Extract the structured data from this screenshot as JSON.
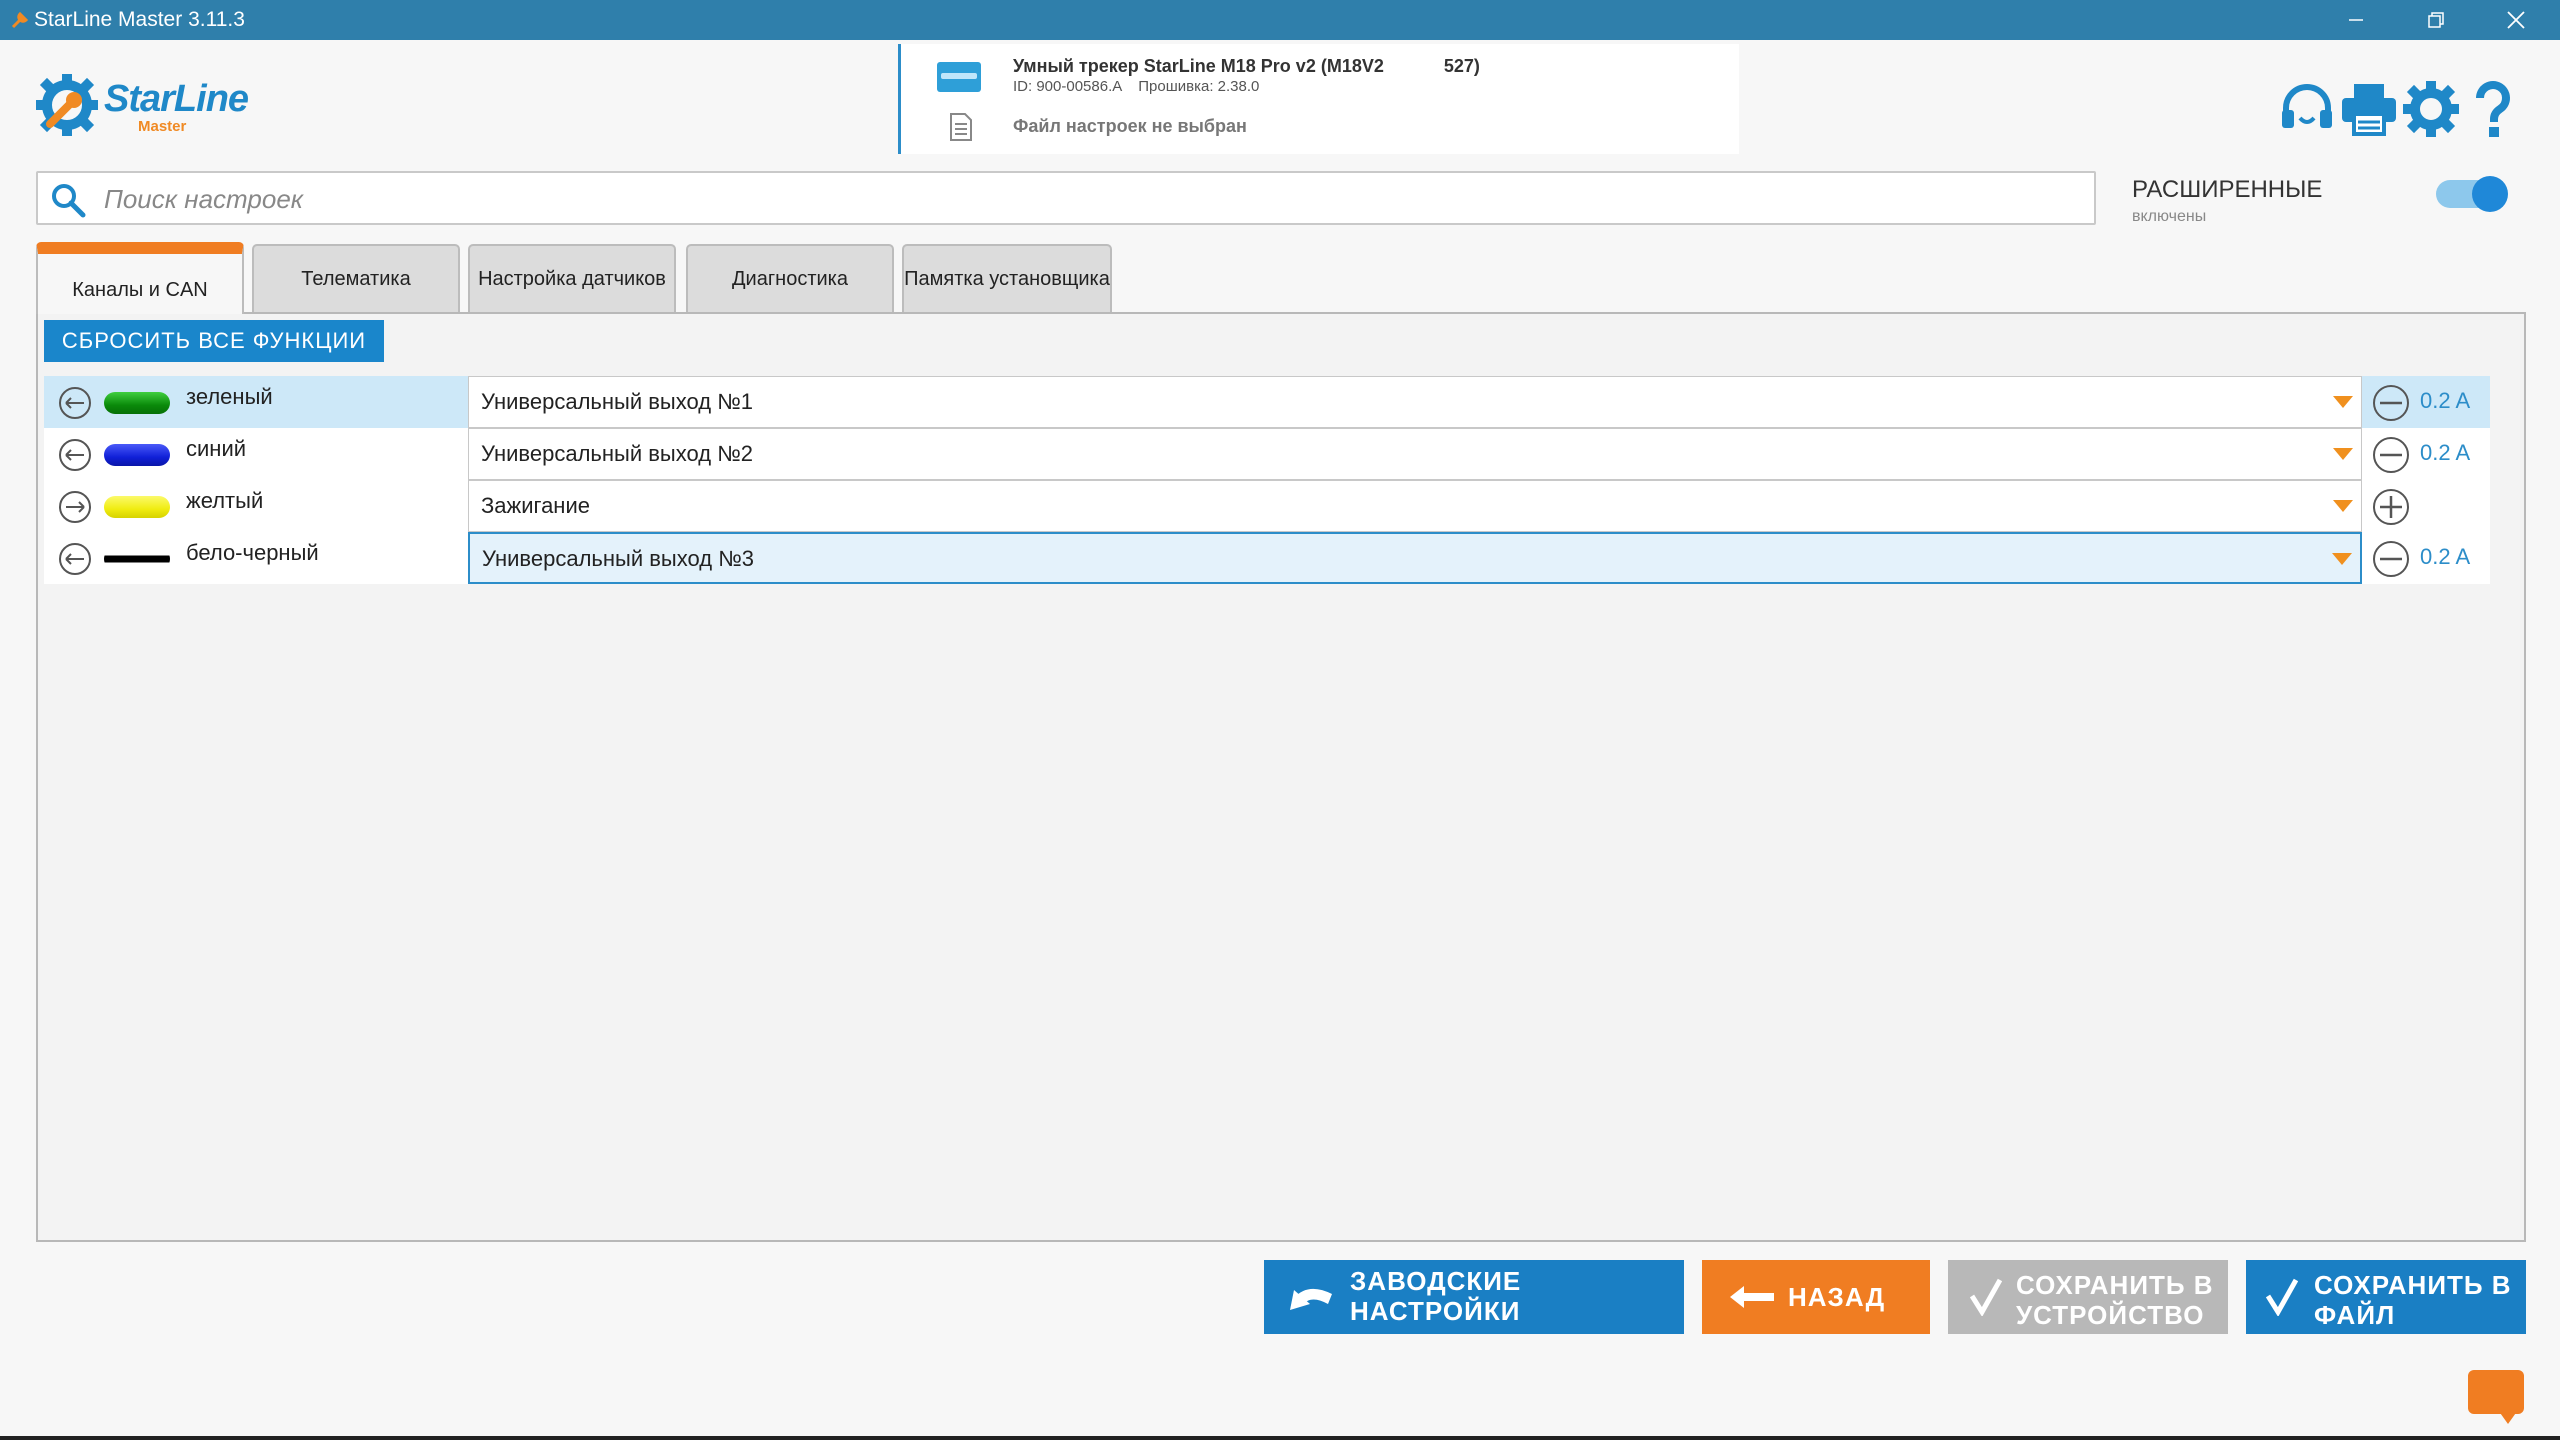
{
  "window": {
    "title": "StarLine Master 3.11.3",
    "titlebar_color": "#2f7fab",
    "controls": [
      "minimize-icon",
      "restore-icon",
      "close-icon"
    ]
  },
  "logo": {
    "word": "StarLine",
    "sub": "Master"
  },
  "device": {
    "name": "Умный трекер StarLine M18 Pro v2 (M18V2            527)",
    "id": "ID: 900-00586.A",
    "firmware": "Прошивка: 2.38.0",
    "file_status": "Файл настроек не выбран"
  },
  "header_icons": [
    "headset-icon",
    "printer-icon",
    "gear-icon",
    "help-icon"
  ],
  "search": {
    "placeholder": "Поиск настроек",
    "value": ""
  },
  "advanced": {
    "title": "РАСШИРЕННЫЕ",
    "status": "включены",
    "enabled": true
  },
  "tabs": [
    {
      "label": "Каналы и CAN",
      "active": true
    },
    {
      "label": "Телематика"
    },
    {
      "label": "Настройка датчиков"
    },
    {
      "label": "Диагностика"
    },
    {
      "label": "Памятка установщика"
    }
  ],
  "reset_button": "СБРОСИТЬ ВСЕ ФУНКЦИИ",
  "channels": [
    {
      "wire": "зеленый",
      "color": "#15a615",
      "function": "Универсальный выход №1",
      "current": "0.2 A",
      "current_icon": "minus-circle-icon"
    },
    {
      "wire": "синий",
      "color": "#1525e0",
      "function": "Универсальный выход №2",
      "current": "0.2 A",
      "current_icon": "minus-circle-icon"
    },
    {
      "wire": "желтый",
      "color": "#f2ef12",
      "function": "Зажигание",
      "current": "",
      "current_icon": "plus-circle-icon"
    },
    {
      "wire": "бело-черный",
      "color": "#ffffff",
      "function": "Универсальный выход №3",
      "current": "0.2 A",
      "current_icon": "minus-circle-icon"
    }
  ],
  "buttons": {
    "factory": "ЗАВОДСКИЕ НАСТРОЙКИ",
    "back": "НАЗАД",
    "save_device": "СОХРАНИТЬ В УСТРОЙСТВО",
    "save_file": "СОХРАНИТЬ В ФАЙЛ"
  },
  "colors": {
    "accent": "#1a86cb",
    "orange": "#f07d22",
    "disabled": "#b8b8b8"
  }
}
